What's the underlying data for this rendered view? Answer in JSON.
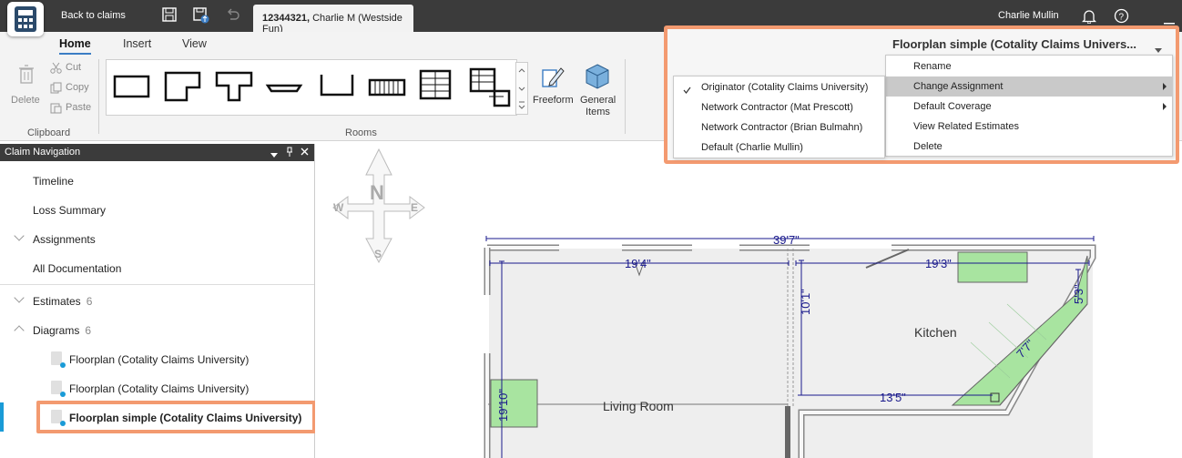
{
  "topbar": {
    "back_label": "Back to claims",
    "tab_claim_number": "12344321,",
    "tab_claim_name": "Charlie M (Westside Fun)",
    "user_name": "Charlie Mullin"
  },
  "ribbon": {
    "tabs": [
      "Home",
      "Insert",
      "View"
    ],
    "clipboard": {
      "delete": "Delete",
      "cut": "Cut",
      "copy": "Copy",
      "paste": "Paste",
      "group": "Clipboard"
    },
    "rooms": {
      "group": "Rooms"
    },
    "freeform": "Freeform",
    "general_items_1": "General",
    "general_items_2": "Items"
  },
  "diagram_dropdown": {
    "label": "Floorplan simple (Cotality Claims Univers..."
  },
  "context_menu": [
    "Rename",
    "Change Assignment",
    "Default Coverage",
    "View Related Estimates",
    "Delete"
  ],
  "submenu": [
    "Originator (Cotality Claims University)",
    "Network Contractor (Mat Prescott)",
    "Network Contractor (Brian Bulmahn)",
    "Default (Charlie Mullin)"
  ],
  "nav": {
    "title": "Claim Navigation",
    "timeline": "Timeline",
    "loss_summary": "Loss Summary",
    "assignments": "Assignments",
    "all_docs": "All Documentation",
    "estimates": "Estimates",
    "estimates_count": "6",
    "diagrams": "Diagrams",
    "diagrams_count": "6",
    "diagram_items": [
      "Floorplan (Cotality Claims University)",
      "Floorplan (Cotality Claims University)",
      "Floorplan simple (Cotality Claims University)"
    ]
  },
  "compass": {
    "n": "N",
    "s": "S",
    "e": "E",
    "w": "W"
  },
  "floorplan": {
    "overall": "39'7\"",
    "dim_left": "19'4\"",
    "dim_right": "19'3\"",
    "dim_height": "10'1\"",
    "dim_bottom": "13'5\"",
    "dim_wall": "19'10\"",
    "dim_diag": "7'7\"",
    "dim_side": "5'3\"",
    "room_kitchen": "Kitchen",
    "room_living": "Living Room"
  },
  "colors": {
    "accent": "#3b7dc4",
    "highlight": "#f39a70",
    "dimension": "#1a1a8c",
    "cabinet": "#a8e4a0"
  }
}
